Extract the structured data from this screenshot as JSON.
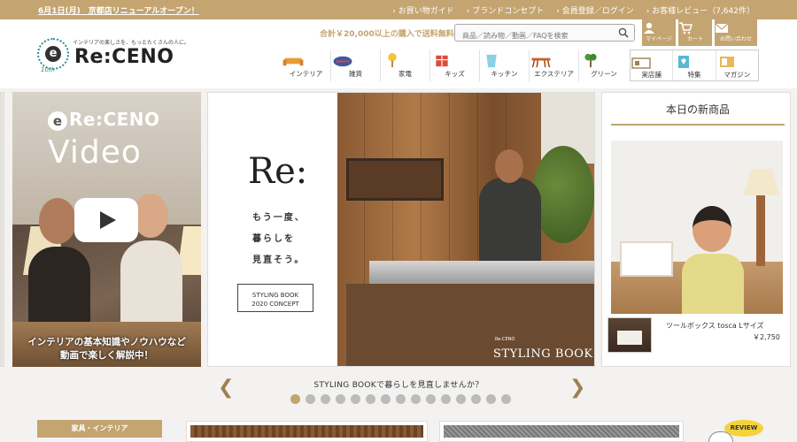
{
  "topbar": {
    "notice": "6月1日(月)　京都店リニューアルオープン！",
    "links": [
      "お買い物ガイド",
      "ブランドコンセプト",
      "会員登録／ログイン",
      "お客様レビュー（7,642件）"
    ]
  },
  "header": {
    "logo_tagline": "インテリアの楽しさを、もっとたくさんの人に。",
    "logo_text": "Re:CENO",
    "logo_letter": "e",
    "logo_anniv": "10th",
    "free_shipping": "合計￥20,000以上の購入で送料無料",
    "search_placeholder": "商品／読み物／動画／FAQを検索",
    "util": [
      {
        "label": "マイページ",
        "icon": "user-icon"
      },
      {
        "label": "カート",
        "icon": "cart-icon"
      },
      {
        "label": "お問い合わせ",
        "icon": "mail-icon"
      }
    ],
    "categories": [
      {
        "label": "インテリア",
        "icon": "sofa-icon"
      },
      {
        "label": "雑貨",
        "icon": "rug-icon"
      },
      {
        "label": "家電",
        "icon": "lamp-icon"
      },
      {
        "label": "キッズ",
        "icon": "toy-icon"
      },
      {
        "label": "キッチン",
        "icon": "cup-icon"
      },
      {
        "label": "エクステリア",
        "icon": "bench-icon"
      },
      {
        "label": "グリーン",
        "icon": "plant-icon"
      }
    ],
    "sub_nav": [
      {
        "label": "実店舗",
        "icon": "store-icon"
      },
      {
        "label": "特集",
        "icon": "feature-icon"
      },
      {
        "label": "マガジン",
        "icon": "magazine-icon"
      }
    ]
  },
  "video_banner": {
    "brand_letter": "e",
    "brand": "Re:CENO",
    "title": "Video",
    "caption_line1": "インテリアの基本知識やノウハウなど",
    "caption_line2": "動画で楽しく解説中！"
  },
  "styling_banner": {
    "heading": "Re:",
    "copy_line1": "もう一度、",
    "copy_line2": "暮らしを",
    "copy_line3": "見直そう。",
    "button_line1": "STYLING BOOK",
    "button_line2": "2020 CONCEPT",
    "photo_logo": "Re:CENO",
    "photo_title": "STYLING BOOK"
  },
  "new_items": {
    "title": "本日の新商品",
    "product_name": "ツールボックス tosca Lサイズ",
    "price": "￥2,750"
  },
  "carousel": {
    "caption": "STYLING BOOKで暮らしを見直しませんか？",
    "prev": "❮",
    "next": "❯",
    "dot_count": 15,
    "active_index": 0
  },
  "section": {
    "label": "家具・インテリア"
  },
  "review_badge": "REVIEW",
  "colors": {
    "accent": "#c4a470",
    "review_yellow": "#f4d23a"
  }
}
